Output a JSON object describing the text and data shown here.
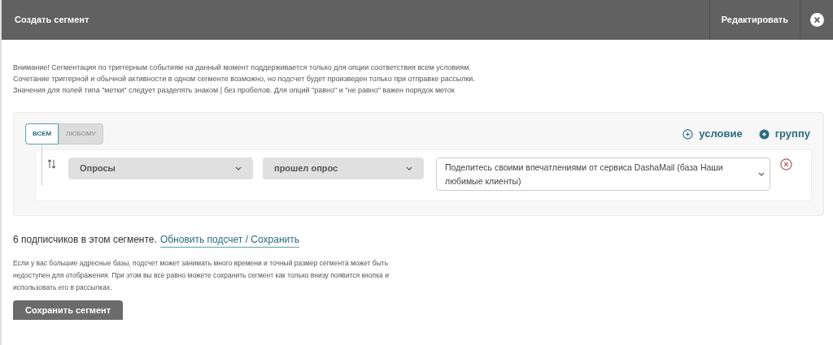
{
  "header": {
    "title": "Создать сегмент",
    "edit_button": "Редактировать"
  },
  "notice": [
    "Внимание! Сегментация по триггерным событиям на данный момент поддерживается только для опции соответствия всем условиям. Сочетание триггерной и обычной активности в одном сегменте возможно, но подсчет будет произведен только при отправке рассылки.",
    "Значения для полей типа \"метки\" следует разделять знаком | без пробелов. Для опций \"равно\" и \"не равно\" важен порядок меток"
  ],
  "match_mode": [
    {
      "label": "ВСЕМ",
      "selected": true
    },
    {
      "label": "ЛЮБОМУ",
      "selected": false
    }
  ],
  "add_actions": [
    {
      "label": "условие",
      "kind": "outline"
    },
    {
      "label": "группу",
      "kind": "filled"
    }
  ],
  "conditions": [
    {
      "field": "Опросы",
      "operator": "прошел опрос",
      "value": "Поделитесь своими впечатлениями от сервиса DashaMail (база Наши любимые клиенты)"
    }
  ],
  "count": {
    "text": "6 подписчиков в этом сегменте.",
    "link": "Обновить подсчет / Сохранить"
  },
  "hint": "Если у вас большие адресные базы, подсчет может занимать много времени и точный размер сегмента может быть недоступен для отображения. При этом вы все равно можете сохранить сегмент как только внизу появится кнопка и использовать его в рассылках.",
  "save_button": "Сохранить сегмент"
}
